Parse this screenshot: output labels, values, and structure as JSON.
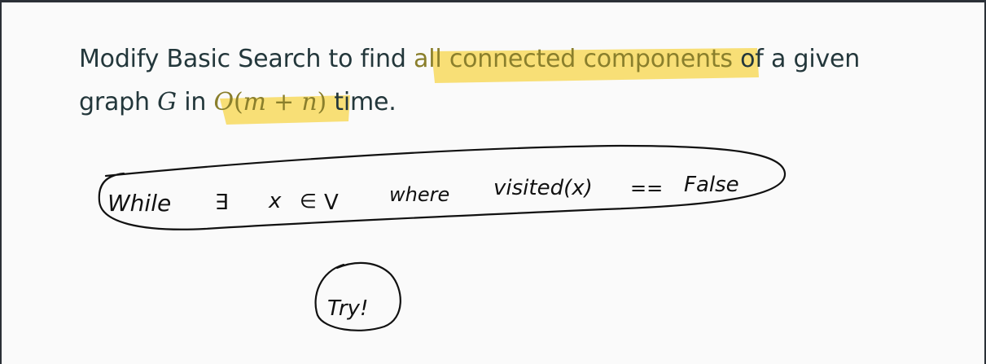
{
  "slide": {
    "line1": {
      "before": "Modify Basic Search to find ",
      "highlight": "all connected components",
      "after": " of a given"
    },
    "line2": {
      "before": "graph ",
      "var_g": "G",
      "mid": " in ",
      "complexity": {
        "o": "O",
        "open": "(",
        "m": "m",
        "plus": " + ",
        "n": "n",
        "close": ")"
      },
      "after": " time."
    }
  },
  "annotations": {
    "handwriting": {
      "while": "While",
      "exists": "∃",
      "x": "x",
      "in": "∈",
      "v": "V",
      "where": "where",
      "visited": "visited(x)",
      "equals": "==",
      "false": "False",
      "try": "Try!"
    },
    "highlight_color": "#f7d64a",
    "ink_color": "#111111"
  }
}
